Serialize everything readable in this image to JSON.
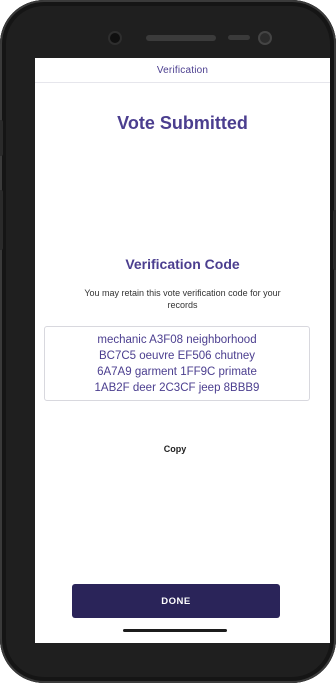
{
  "header": {
    "title": "Verification"
  },
  "main": {
    "title": "Vote Submitted",
    "code_heading": "Verification Code",
    "retain_text": "You may retain this vote verification code for your records",
    "code_lines": [
      "mechanic A3F08 neighborhood",
      "BC7C5 oeuvre EF506 chutney",
      "6A7A9 garment 1FF9C primate",
      "1AB2F deer 2C3CF jeep 8BBB9"
    ],
    "copy_label": "Copy",
    "done_label": "DONE"
  },
  "colors": {
    "accent": "#4b3e8f",
    "button_bg": "#2a2459"
  }
}
